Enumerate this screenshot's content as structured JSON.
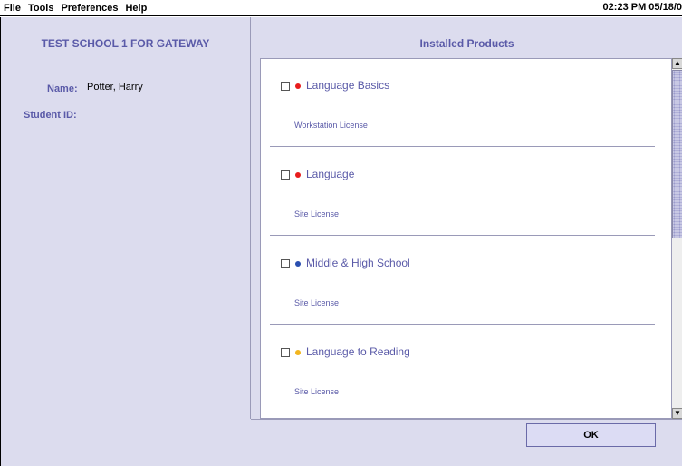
{
  "menu": [
    "File",
    "Tools",
    "Preferences",
    "Help"
  ],
  "clock": "02:23 PM 05/18/0",
  "left": {
    "school_name": "TEST SCHOOL 1 FOR GATEWAY",
    "name_label": "Name:",
    "name_value": "Potter, Harry",
    "student_id_label": "Student ID:"
  },
  "products": {
    "title": "Installed Products",
    "items": [
      {
        "name": "Language Basics",
        "license": "Workstation License",
        "dot_color": "#e81c1c",
        "checked": false
      },
      {
        "name": "Language",
        "license": "Site License",
        "dot_color": "#e81c1c",
        "checked": false
      },
      {
        "name": "Middle & High School",
        "license": "Site License",
        "dot_color": "#2a4fb0",
        "checked": false
      },
      {
        "name": "Language to Reading",
        "license": "Site License",
        "dot_color": "#f2b51e",
        "checked": false
      }
    ]
  },
  "ok_label": "OK",
  "colors": {
    "accent_text": "#5a5aa8",
    "panel_bg": "#dcdcee"
  }
}
